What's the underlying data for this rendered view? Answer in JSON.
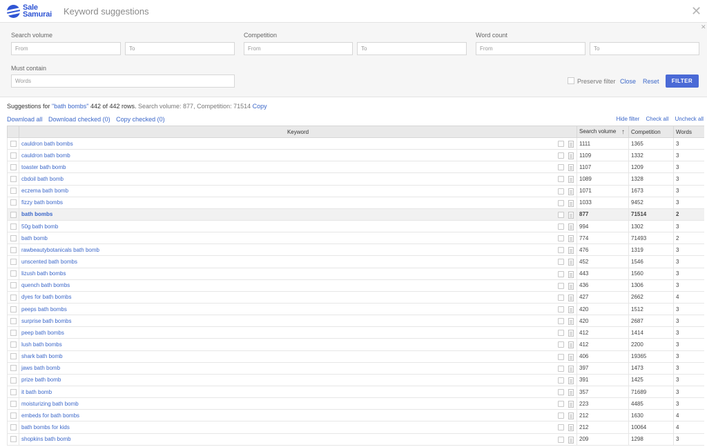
{
  "header": {
    "logo_line1": "Sale",
    "logo_line2": "Samurai",
    "title": "Keyword suggestions"
  },
  "filters": {
    "search_volume_label": "Search volume",
    "competition_label": "Competition",
    "word_count_label": "Word count",
    "must_contain_label": "Must contain",
    "from_placeholder": "From",
    "to_placeholder": "To",
    "words_placeholder": "Words",
    "preserve_filter_label": "Preserve filter",
    "close_label": "Close",
    "reset_label": "Reset",
    "filter_button": "FILTER"
  },
  "summary": {
    "prefix": "Suggestions for ",
    "keyword": "\"bath bombs\"",
    "count_text": " 442 of 442 rows.",
    "meta": " Search volume: 877, Competition: 71514 ",
    "copy": "Copy"
  },
  "actions": {
    "download_all": "Download all",
    "download_checked": "Download checked (0)",
    "copy_checked": "Copy checked (0)",
    "hide_filter": "Hide filter",
    "check_all": "Check all",
    "uncheck_all": "Uncheck all"
  },
  "table": {
    "headers": {
      "keyword": "Keyword",
      "search_volume": "Search volume",
      "competition": "Competition",
      "words": "Words"
    },
    "sort_indicator": "↑",
    "highlight_index": 6,
    "rows": [
      {
        "keyword": "cauldron bath bombs",
        "volume": "1111",
        "competition": "1365",
        "words": "3"
      },
      {
        "keyword": "cauldron bath bomb",
        "volume": "1109",
        "competition": "1332",
        "words": "3"
      },
      {
        "keyword": "toaster bath bomb",
        "volume": "1107",
        "competition": "1209",
        "words": "3"
      },
      {
        "keyword": "cbdoil bath bomb",
        "volume": "1089",
        "competition": "1328",
        "words": "3"
      },
      {
        "keyword": "eczema bath bomb",
        "volume": "1071",
        "competition": "1673",
        "words": "3"
      },
      {
        "keyword": "fizzy bath bombs",
        "volume": "1033",
        "competition": "9452",
        "words": "3"
      },
      {
        "keyword": "bath bombs",
        "volume": "877",
        "competition": "71514",
        "words": "2"
      },
      {
        "keyword": "50g bath bomb",
        "volume": "994",
        "competition": "1302",
        "words": "3"
      },
      {
        "keyword": "bath bomb",
        "volume": "774",
        "competition": "71493",
        "words": "2"
      },
      {
        "keyword": "rawbeautybotanicals bath bomb",
        "volume": "476",
        "competition": "1319",
        "words": "3"
      },
      {
        "keyword": "unscented bath bombs",
        "volume": "452",
        "competition": "1546",
        "words": "3"
      },
      {
        "keyword": "lizush bath bombs",
        "volume": "443",
        "competition": "1560",
        "words": "3"
      },
      {
        "keyword": "quench bath bombs",
        "volume": "436",
        "competition": "1306",
        "words": "3"
      },
      {
        "keyword": "dyes for bath bombs",
        "volume": "427",
        "competition": "2662",
        "words": "4"
      },
      {
        "keyword": "peeps bath bombs",
        "volume": "420",
        "competition": "1512",
        "words": "3"
      },
      {
        "keyword": "surprise bath bombs",
        "volume": "420",
        "competition": "2687",
        "words": "3"
      },
      {
        "keyword": "peep bath bombs",
        "volume": "412",
        "competition": "1414",
        "words": "3"
      },
      {
        "keyword": "lush bath bombs",
        "volume": "412",
        "competition": "2200",
        "words": "3"
      },
      {
        "keyword": "shark bath bomb",
        "volume": "406",
        "competition": "19365",
        "words": "3"
      },
      {
        "keyword": "jaws bath bomb",
        "volume": "397",
        "competition": "1473",
        "words": "3"
      },
      {
        "keyword": "prize bath bomb",
        "volume": "391",
        "competition": "1425",
        "words": "3"
      },
      {
        "keyword": "it bath bomb",
        "volume": "357",
        "competition": "71689",
        "words": "3"
      },
      {
        "keyword": "moisturizing bath bomb",
        "volume": "223",
        "competition": "4485",
        "words": "3"
      },
      {
        "keyword": "embeds for bath bombs",
        "volume": "212",
        "competition": "1630",
        "words": "4"
      },
      {
        "keyword": "bath bombs for kids",
        "volume": "212",
        "competition": "10064",
        "words": "4"
      },
      {
        "keyword": "shopkins bath bomb",
        "volume": "209",
        "competition": "1298",
        "words": "3"
      }
    ]
  }
}
